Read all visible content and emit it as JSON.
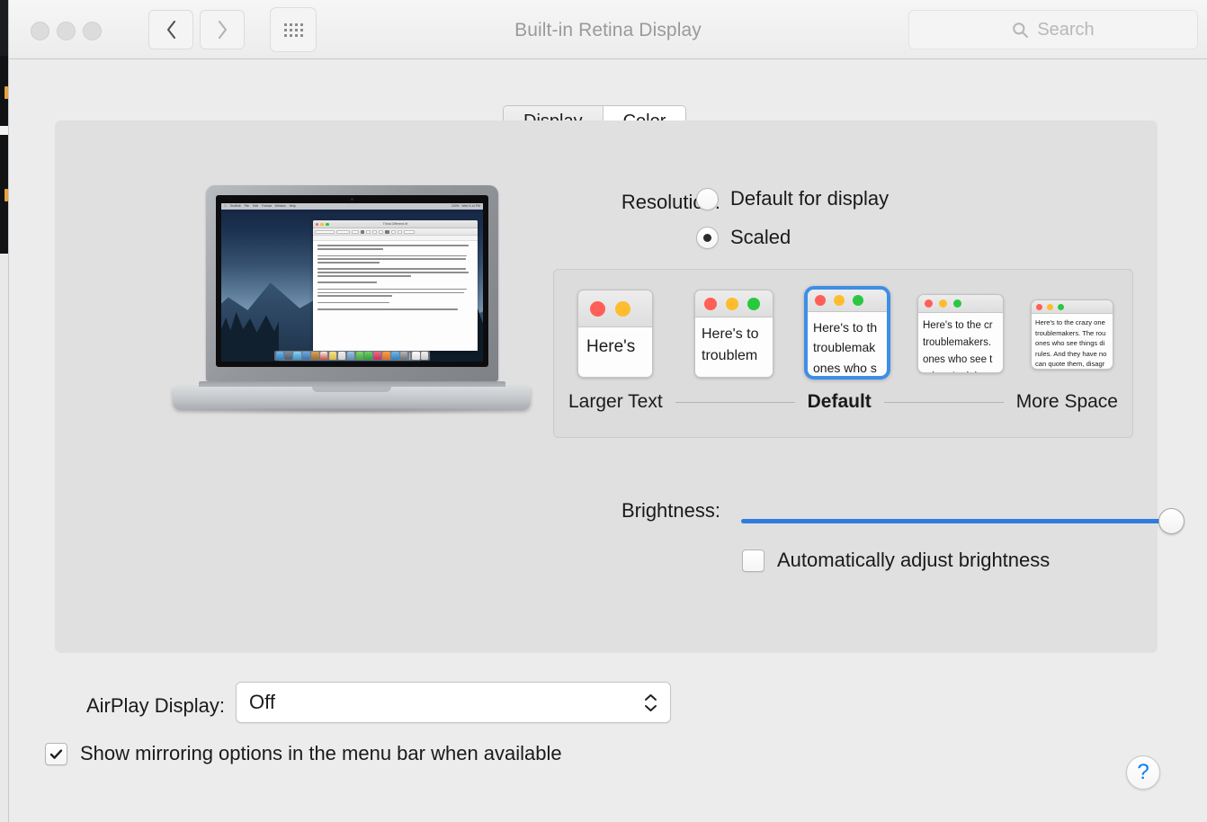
{
  "window": {
    "title": "Built-in Retina Display",
    "traffic_lights": [
      "close",
      "minimize",
      "zoom"
    ],
    "nav": {
      "back": "back",
      "forward": "forward",
      "show_all": "show-all-grid"
    }
  },
  "search": {
    "placeholder": "Search",
    "value": "",
    "icon": "search-icon"
  },
  "tabs": [
    {
      "label": "Display",
      "selected": false
    },
    {
      "label": "Color",
      "selected": true
    }
  ],
  "preview": {
    "device": "MacBook Pro Retina",
    "document_title": "Think Different.rtf",
    "menubar_items": [
      "TextEdit",
      "File",
      "Edit",
      "Format",
      "Window",
      "Help"
    ],
    "menubar_status": [
      "100%",
      "Wed 3:14 PM"
    ],
    "dock_icons": [
      "finder",
      "launchpad",
      "safari",
      "mail",
      "contacts",
      "calendar",
      "notes",
      "reminders",
      "maps",
      "messages",
      "facetime",
      "itunes",
      "ibooks",
      "app-store",
      "system-preferences",
      "documents",
      "trash"
    ],
    "body_text": "Here's to the crazy ones. The misfits. The rebels. The troublemakers. The round pegs in the square holes."
  },
  "resolution": {
    "label": "Resolution:",
    "options": [
      {
        "label": "Default for display",
        "selected": false
      },
      {
        "label": "Scaled",
        "selected": true
      }
    ]
  },
  "scaling": {
    "legend_left": "Larger Text",
    "legend_center": "Default",
    "legend_right": "More Space",
    "selected_index": 2,
    "thumbnails": [
      {
        "name": "larger-text-most",
        "text": "Here's",
        "selected": false
      },
      {
        "name": "larger-text",
        "text": "Here's to\ntroublem",
        "selected": false
      },
      {
        "name": "default",
        "text": "Here's to th\ntroublemak\nones who s",
        "selected": true
      },
      {
        "name": "more-space",
        "text": "Here's to the cr\ntroublemakers.\nones who see t\nrules. And they",
        "selected": false
      },
      {
        "name": "more-space-most",
        "text": "Here's to the crazy one\ntroublemakers. The rou\nones who see things di\nrules. And they have no\ncan quote them, disagr\nthem. About the only th\nBecause they change t",
        "selected": false
      }
    ]
  },
  "brightness": {
    "label": "Brightness:",
    "value": 100,
    "min": 0,
    "max": 100,
    "accent_color": "#2f7ce0",
    "auto_adjust": {
      "label": "Automatically adjust brightness",
      "checked": false
    }
  },
  "airplay": {
    "label": "AirPlay Display:",
    "value": "Off",
    "options": [
      "Off"
    ]
  },
  "mirroring": {
    "label": "Show mirroring options in the menu bar when available",
    "checked": true
  },
  "help": {
    "label": "?",
    "color": "#0a7cf5"
  }
}
